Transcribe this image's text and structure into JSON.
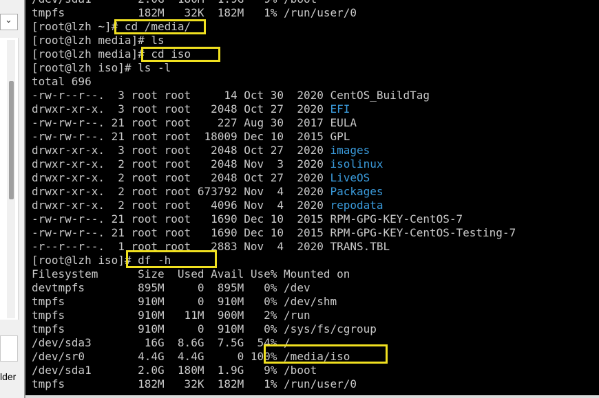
{
  "sidebar": {
    "chevron": "⌄",
    "label": "lder"
  },
  "terminal": {
    "lines": [
      [
        {
          "t": "/dev/sda1       2.0G  180M  1.9G   9% /boot"
        }
      ],
      [
        {
          "t": "tmpfs           182M   32K  182M   1% /run/user/0"
        }
      ],
      [
        {
          "t": "[root@lzh ~]# cd /media/"
        }
      ],
      [
        {
          "t": "[root@lzh media]# ls"
        }
      ],
      [
        {
          "t": "[root@lzh media]# cd iso"
        }
      ],
      [
        {
          "t": "[root@lzh iso]# ls -l"
        }
      ],
      [
        {
          "t": "total 696"
        }
      ],
      [
        {
          "t": "-rw-r--r--.  3 root root     14 Oct 30  2020 CentOS_BuildTag"
        }
      ],
      [
        {
          "t": "drwxr-xr-x.  3 root root   2048 Oct 27  2020 "
        },
        {
          "t": "EFI",
          "dir": true
        }
      ],
      [
        {
          "t": "-rw-rw-r--. 21 root root    227 Aug 30  2017 EULA"
        }
      ],
      [
        {
          "t": "-rw-rw-r--. 21 root root  18009 Dec 10  2015 GPL"
        }
      ],
      [
        {
          "t": "drwxr-xr-x.  3 root root   2048 Oct 27  2020 "
        },
        {
          "t": "images",
          "dir": true
        }
      ],
      [
        {
          "t": "drwxr-xr-x.  2 root root   2048 Nov  3  2020 "
        },
        {
          "t": "isolinux",
          "dir": true
        }
      ],
      [
        {
          "t": "drwxr-xr-x.  2 root root   2048 Oct 27  2020 "
        },
        {
          "t": "LiveOS",
          "dir": true
        }
      ],
      [
        {
          "t": "drwxr-xr-x.  2 root root 673792 Nov  4  2020 "
        },
        {
          "t": "Packages",
          "dir": true
        }
      ],
      [
        {
          "t": "drwxr-xr-x.  2 root root   4096 Nov  4  2020 "
        },
        {
          "t": "repodata",
          "dir": true
        }
      ],
      [
        {
          "t": "-rw-rw-r--. 21 root root   1690 Dec 10  2015 RPM-GPG-KEY-CentOS-7"
        }
      ],
      [
        {
          "t": "-rw-rw-r--. 21 root root   1690 Dec 10  2015 RPM-GPG-KEY-CentOS-Testing-7"
        }
      ],
      [
        {
          "t": "-r--r--r--.  1 root root   2883 Nov  4  2020 TRANS.TBL"
        }
      ],
      [
        {
          "t": "[root@lzh iso]# df -h"
        }
      ],
      [
        {
          "t": "Filesystem      Size  Used Avail Use% Mounted on"
        }
      ],
      [
        {
          "t": "devtmpfs        895M     0  895M   0% /dev"
        }
      ],
      [
        {
          "t": "tmpfs           910M     0  910M   0% /dev/shm"
        }
      ],
      [
        {
          "t": "tmpfs           910M   11M  900M   2% /run"
        }
      ],
      [
        {
          "t": "tmpfs           910M     0  910M   0% /sys/fs/cgroup"
        }
      ],
      [
        {
          "t": "/dev/sda3        16G  8.6G  7.5G  54% /"
        }
      ],
      [
        {
          "t": "/dev/sr0        4.4G  4.4G     0 100% /media/iso"
        }
      ],
      [
        {
          "t": "/dev/sda1       2.0G  180M  1.9G   9% /boot"
        }
      ],
      [
        {
          "t": "tmpfs           182M   32K  182M   1% /run/user/0"
        }
      ]
    ]
  }
}
